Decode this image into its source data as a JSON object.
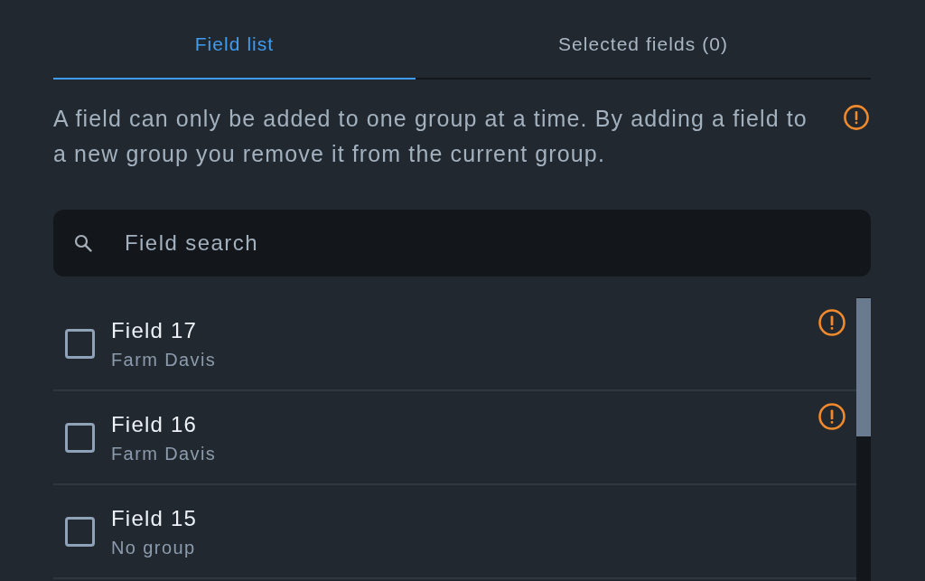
{
  "tabs": [
    {
      "label": "Field list",
      "selected": true
    },
    {
      "label": "Selected fields (0)",
      "selected": false
    }
  ],
  "notice": {
    "text": "A field can only be added to one group at a time. By adding a field to a new group you remove it from the current group."
  },
  "search": {
    "placeholder": "Field search"
  },
  "fields": [
    {
      "name": "Field 17",
      "group": "Farm Davis",
      "checked": false,
      "warning": true
    },
    {
      "name": "Field 16",
      "group": "Farm Davis",
      "checked": false,
      "warning": true
    },
    {
      "name": "Field 15",
      "group": "No group",
      "checked": false,
      "warning": false
    }
  ]
}
